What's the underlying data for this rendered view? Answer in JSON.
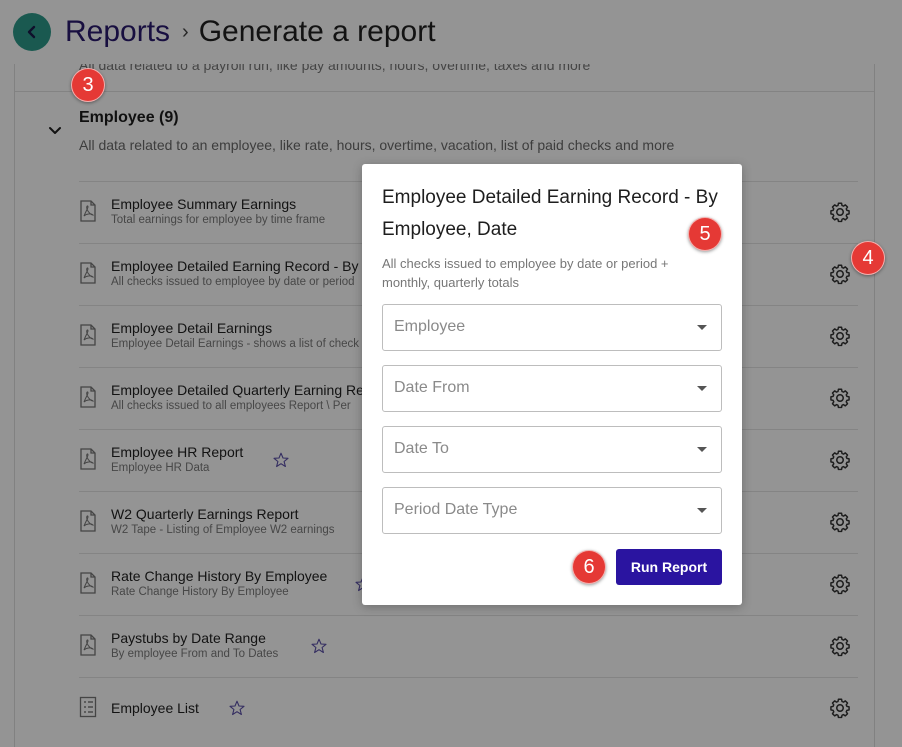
{
  "header": {
    "breadcrumb_root": "Reports",
    "breadcrumb_separator": "›",
    "breadcrumb_current": "Generate a report"
  },
  "previous_section": {
    "description": "All data related to a payroll run, like pay amounts, hours, overtime, taxes and more"
  },
  "section": {
    "title": "Employee (9)",
    "description": "All data related to an employee, like rate, hours, overtime, vacation, list of paid checks and more"
  },
  "reports": [
    {
      "title": "Employee Summary Earnings",
      "subtitle": "Total earnings for employee by time frame",
      "icon": "pdf-doc-icon"
    },
    {
      "title": "Employee Detailed Earning Record - By",
      "subtitle": "All checks issued to employee by date or period",
      "icon": "pdf-doc-icon"
    },
    {
      "title": "Employee Detail Earnings",
      "subtitle": "Employee Detail Earnings - shows a list of check",
      "icon": "pdf-doc-icon"
    },
    {
      "title": "Employee Detailed Quarterly Earning Re",
      "subtitle": "All checks issued to all employees Report \\ Per",
      "icon": "pdf-doc-icon"
    },
    {
      "title": "Employee HR Report",
      "subtitle": "Employee HR Data",
      "icon": "pdf-doc-icon"
    },
    {
      "title": "W2 Quarterly Earnings Report",
      "subtitle": "W2 Tape - Listing of Employee W2 earnings",
      "icon": "pdf-doc-icon"
    },
    {
      "title": "Rate Change History By Employee",
      "subtitle": "Rate Change History By Employee",
      "icon": "pdf-doc-icon"
    },
    {
      "title": "Paystubs by Date Range",
      "subtitle": "By employee From and To Dates",
      "icon": "pdf-doc-icon"
    },
    {
      "title": "Employee List",
      "subtitle": "",
      "icon": "spreadsheet-icon"
    }
  ],
  "modal": {
    "title": "Employee Detailed Earning Record - By Employee, Date",
    "description": "All checks issued to employee by date or period + monthly, quarterly totals",
    "fields": [
      {
        "placeholder": "Employee"
      },
      {
        "placeholder": "Date From"
      },
      {
        "placeholder": "Date To"
      },
      {
        "placeholder": "Period Date Type"
      }
    ],
    "run_button_label": "Run Report"
  },
  "badges": [
    "3",
    "4",
    "5",
    "6"
  ],
  "colors": {
    "accent": "#2a14a0",
    "back_button": "#2e9a8a",
    "badge": "#e53935",
    "breadcrumb_root": "#2a1a6e"
  }
}
